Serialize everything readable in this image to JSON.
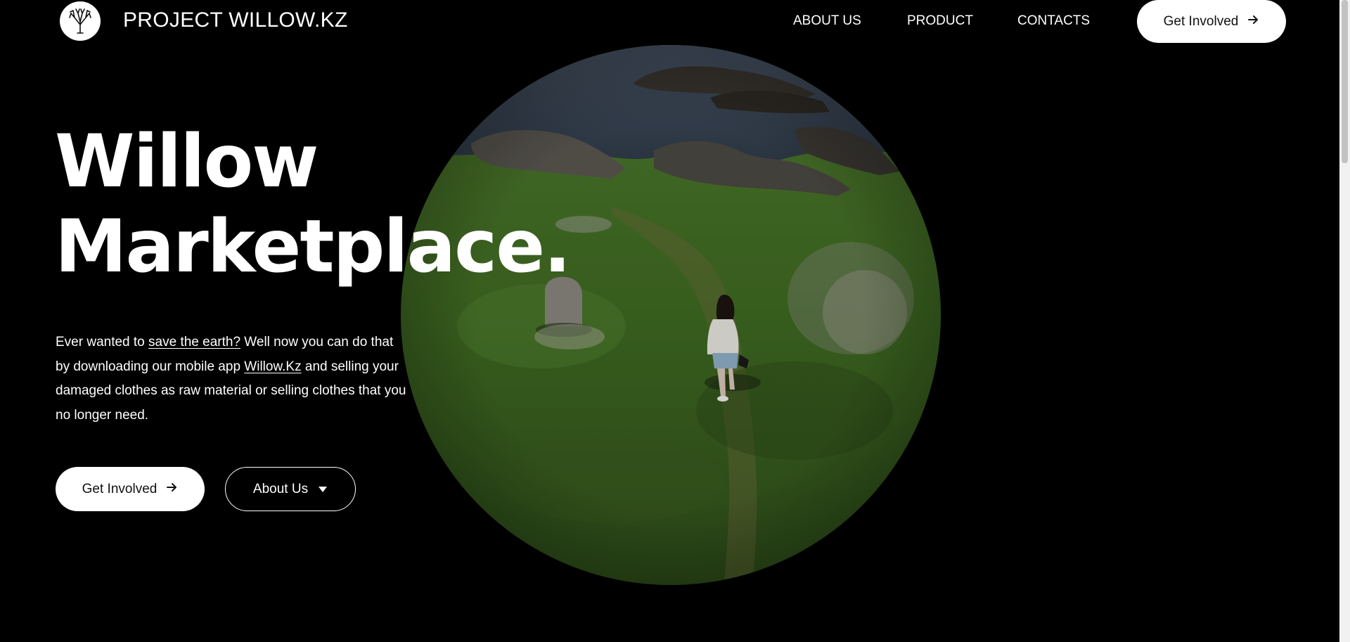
{
  "header": {
    "brand": "PROJECT WILLOW.KZ",
    "logo_icon": "willow-tree-logo",
    "nav": [
      {
        "label": "ABOUT US"
      },
      {
        "label": "PRODUCT"
      },
      {
        "label": "CONTACTS"
      }
    ],
    "cta_label": "Get Involved",
    "cta_icon": "arrow-right-icon"
  },
  "hero": {
    "headline_line1": "Willow",
    "headline_line2": "Marketplace.",
    "desc_part1": "Ever wanted to ",
    "desc_link1": "save the earth?",
    "desc_part2": " Well now you can do that by downloading our mobile app ",
    "desc_link2": "Willow.Kz",
    "desc_part3": " and selling your damaged clothes as raw material or selling clothes that you no longer need.",
    "primary_button": "Get Involved",
    "secondary_button": "About Us",
    "image_description_icon": "hero-photo-coastal-meadow"
  },
  "colors": {
    "background": "#000000",
    "text": "#ffffff",
    "button_bg": "#ffffff",
    "button_text": "#111111"
  }
}
